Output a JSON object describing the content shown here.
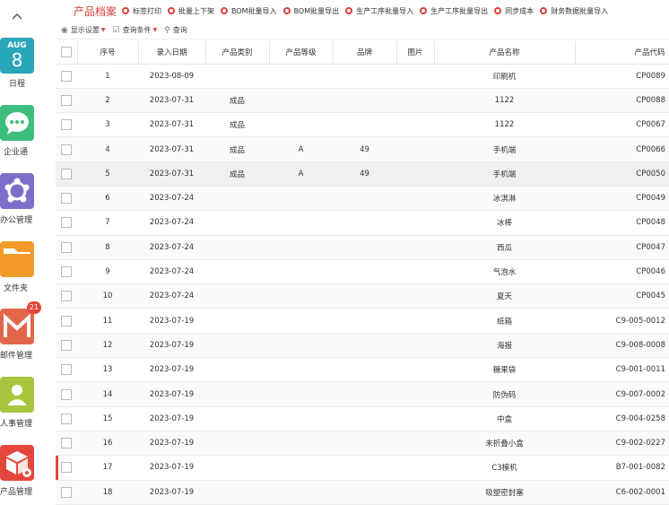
{
  "sidebar": {
    "collapse_icon": "chevron-up-icon",
    "apps": [
      {
        "id": "calendar",
        "label": "日程",
        "month": "AUG",
        "day": "8",
        "color": "#2aa6b9"
      },
      {
        "id": "chat",
        "label": "企业通",
        "icon": "chat-bubble-icon",
        "color": "#3dbe7c"
      },
      {
        "id": "office",
        "label": "办公管理",
        "icon": "network-icon",
        "color": "#7e6ec9"
      },
      {
        "id": "folder",
        "label": "文件夹",
        "icon": "folder-icon",
        "color": "#f39b2a"
      },
      {
        "id": "mail",
        "label": "邮件管理",
        "icon": "mail-icon",
        "color": "#e2674a",
        "badge": "21"
      },
      {
        "id": "hr",
        "label": "人事管理",
        "icon": "person-icon",
        "color": "#a9c53d"
      },
      {
        "id": "product",
        "label": "产品管理",
        "icon": "box-icon",
        "color": "#e4463b"
      }
    ]
  },
  "toolbar": {
    "title": "产品档案",
    "actions": [
      "标签打印",
      "批量上下架",
      "BOM批量导入",
      "BOM批量导出",
      "生产工序批量导入",
      "生产工序批量导出",
      "同步成本",
      "财务数据批量导入"
    ]
  },
  "filterbar": {
    "display_settings": "显示设置",
    "query_conditions": "查询条件",
    "query": "查询"
  },
  "table": {
    "columns": [
      "序号",
      "录入日期",
      "产品类别",
      "产品等级",
      "品牌",
      "图片",
      "产品名称",
      "产品代码"
    ],
    "rows": [
      [
        "1",
        "2023-08-09",
        "",
        "",
        "",
        "",
        "印刷机",
        "CP0089"
      ],
      [
        "2",
        "2023-07-31",
        "成品",
        "",
        "",
        "",
        "1122",
        "CP0088"
      ],
      [
        "3",
        "2023-07-31",
        "成品",
        "",
        "",
        "",
        "1122",
        "CP0067"
      ],
      [
        "4",
        "2023-07-31",
        "成品",
        "A",
        "49",
        "",
        "手机端",
        "CP0066"
      ],
      [
        "5",
        "2023-07-31",
        "成品",
        "A",
        "49",
        "",
        "手机端",
        "CP0050"
      ],
      [
        "6",
        "2023-07-24",
        "",
        "",
        "",
        "",
        "冰淇淋",
        "CP0049"
      ],
      [
        "7",
        "2023-07-24",
        "",
        "",
        "",
        "",
        "冰棒",
        "CP0048"
      ],
      [
        "8",
        "2023-07-24",
        "",
        "",
        "",
        "",
        "西瓜",
        "CP0047"
      ],
      [
        "9",
        "2023-07-24",
        "",
        "",
        "",
        "",
        "气泡水",
        "CP0046"
      ],
      [
        "10",
        "2023-07-24",
        "",
        "",
        "",
        "",
        "夏天",
        "CP0045"
      ],
      [
        "11",
        "2023-07-19",
        "",
        "",
        "",
        "",
        "纸箱",
        "C9-005-0012"
      ],
      [
        "12",
        "2023-07-19",
        "",
        "",
        "",
        "",
        "海报",
        "C9-008-0008"
      ],
      [
        "13",
        "2023-07-19",
        "",
        "",
        "",
        "",
        "糖果袋",
        "C9-001-0011"
      ],
      [
        "14",
        "2023-07-19",
        "",
        "",
        "",
        "",
        "防伪码",
        "C9-007-0002"
      ],
      [
        "15",
        "2023-07-19",
        "",
        "",
        "",
        "",
        "中盒",
        "C9-004-0258"
      ],
      [
        "16",
        "2023-07-19",
        "",
        "",
        "",
        "",
        "未折叠小盒",
        "C9-002-0227"
      ],
      [
        "17",
        "2023-07-19",
        "",
        "",
        "",
        "",
        "C3模机",
        "B7-001-0082"
      ],
      [
        "18",
        "2023-07-19",
        "",
        "",
        "",
        "",
        "吸塑密封塞",
        "C6-002-0001"
      ]
    ]
  }
}
